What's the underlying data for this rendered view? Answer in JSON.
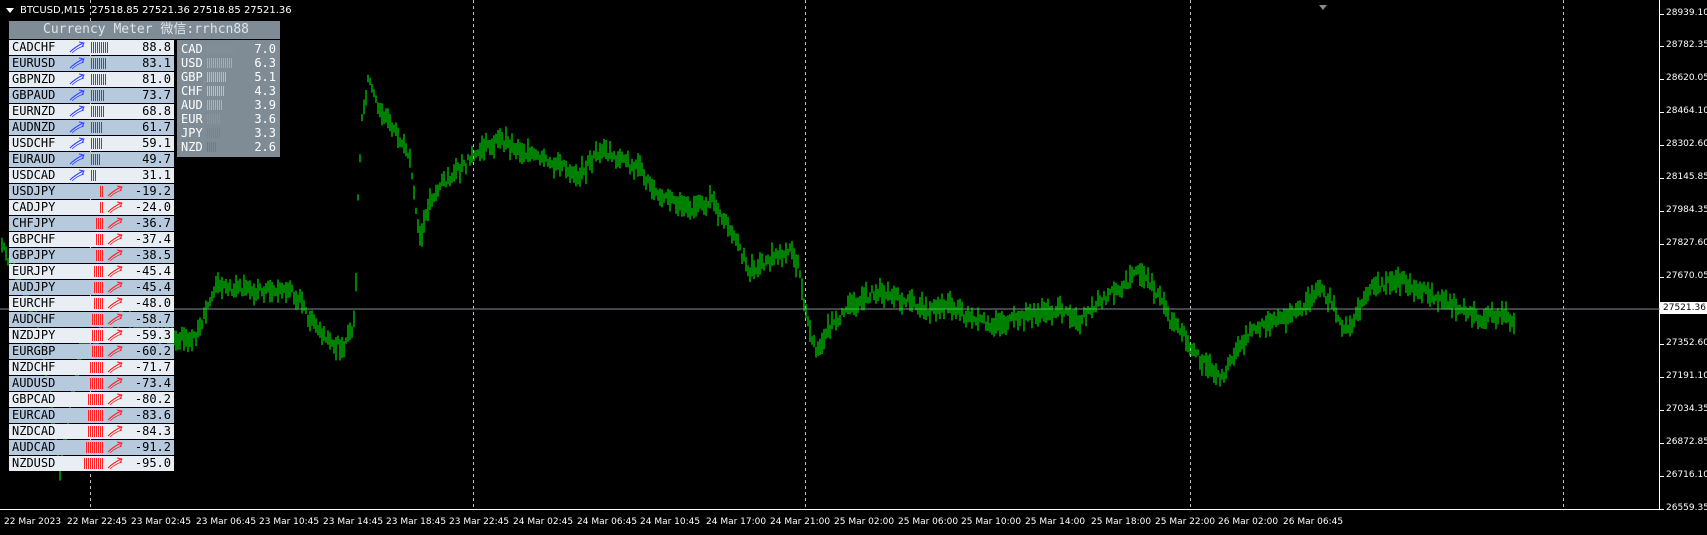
{
  "header": {
    "symbol_timeframe": "BTCUSD,M15",
    "ohlc": "27518.85 27521.36 27518.85 27521.36"
  },
  "price_axis": {
    "ticks": [
      "28939.10",
      "28782.35",
      "28620.05",
      "28464.10",
      "28302.60",
      "28145.85",
      "27984.35",
      "27827.60",
      "27670.05",
      "27352.60",
      "27191.10",
      "27034.35",
      "26872.85",
      "26716.10",
      "26559.35"
    ],
    "current_price": "27521.36"
  },
  "time_axis": {
    "ticks": [
      "22 Mar 2023",
      "22 Mar 22:45",
      "23 Mar 02:45",
      "23 Mar 06:45",
      "23 Mar 10:45",
      "23 Mar 14:45",
      "23 Mar 18:45",
      "23 Mar 22:45",
      "24 Mar 02:45",
      "24 Mar 06:45",
      "24 Mar 10:45",
      "24 Mar 17:00",
      "24 Mar 21:00",
      "25 Mar 02:00",
      "25 Mar 06:00",
      "25 Mar 10:00",
      "25 Mar 14:00",
      "25 Mar 18:00",
      "25 Mar 22:00",
      "26 Mar 02:00",
      "26 Mar 06:45"
    ]
  },
  "meter": {
    "title": "Currency Meter 微信:rrhcn88",
    "pairs": [
      {
        "name": "CADCHF",
        "value": "88.8",
        "dir": "up"
      },
      {
        "name": "EURUSD",
        "value": "83.1",
        "dir": "up"
      },
      {
        "name": "GBPNZD",
        "value": "81.0",
        "dir": "up"
      },
      {
        "name": "GBPAUD",
        "value": "73.7",
        "dir": "up"
      },
      {
        "name": "EURNZD",
        "value": "68.8",
        "dir": "up"
      },
      {
        "name": "AUDNZD",
        "value": "61.7",
        "dir": "up"
      },
      {
        "name": "USDCHF",
        "value": "59.1",
        "dir": "up"
      },
      {
        "name": "EURAUD",
        "value": "49.7",
        "dir": "up"
      },
      {
        "name": "USDCAD",
        "value": "31.1",
        "dir": "up"
      },
      {
        "name": "USDJPY",
        "value": "-19.2",
        "dir": "down"
      },
      {
        "name": "CADJPY",
        "value": "-24.0",
        "dir": "down"
      },
      {
        "name": "CHFJPY",
        "value": "-36.7",
        "dir": "down"
      },
      {
        "name": "GBPCHF",
        "value": "-37.4",
        "dir": "down"
      },
      {
        "name": "GBPJPY",
        "value": "-38.5",
        "dir": "down"
      },
      {
        "name": "EURJPY",
        "value": "-45.4",
        "dir": "down"
      },
      {
        "name": "AUDJPY",
        "value": "-45.4",
        "dir": "down"
      },
      {
        "name": "EURCHF",
        "value": "-48.0",
        "dir": "down"
      },
      {
        "name": "AUDCHF",
        "value": "-58.7",
        "dir": "down"
      },
      {
        "name": "NZDJPY",
        "value": "-59.3",
        "dir": "down"
      },
      {
        "name": "EURGBP",
        "value": "-60.2",
        "dir": "down"
      },
      {
        "name": "NZDCHF",
        "value": "-71.7",
        "dir": "down"
      },
      {
        "name": "AUDUSD",
        "value": "-73.4",
        "dir": "down"
      },
      {
        "name": "GBPCAD",
        "value": "-80.2",
        "dir": "down"
      },
      {
        "name": "EURCAD",
        "value": "-83.6",
        "dir": "down"
      },
      {
        "name": "NZDCAD",
        "value": "-84.3",
        "dir": "down"
      },
      {
        "name": "AUDCAD",
        "value": "-91.2",
        "dir": "down"
      },
      {
        "name": "NZDUSD",
        "value": "-95.0",
        "dir": "down"
      }
    ],
    "currencies": [
      {
        "name": "CAD",
        "value": "7.0",
        "color": "#33cc33"
      },
      {
        "name": "USD",
        "value": "6.3",
        "color": "#99cc33"
      },
      {
        "name": "GBP",
        "value": "5.1",
        "color": "#cccc33"
      },
      {
        "name": "CHF",
        "value": "4.3",
        "color": "#e6cc1a"
      },
      {
        "name": "AUD",
        "value": "3.9",
        "color": "#e6b31a"
      },
      {
        "name": "EUR",
        "value": "3.6",
        "color": "#e67a33"
      },
      {
        "name": "JPY",
        "value": "3.3",
        "color": "#e65c33"
      },
      {
        "name": "NZD",
        "value": "2.6",
        "color": "#e64d33"
      }
    ]
  },
  "colors": {
    "candle": "#00ff00",
    "up_bar": "#3344ff",
    "down_bar": "#ff2222",
    "grid": "#c0c0c0",
    "price_line": "#7f8c96"
  }
}
